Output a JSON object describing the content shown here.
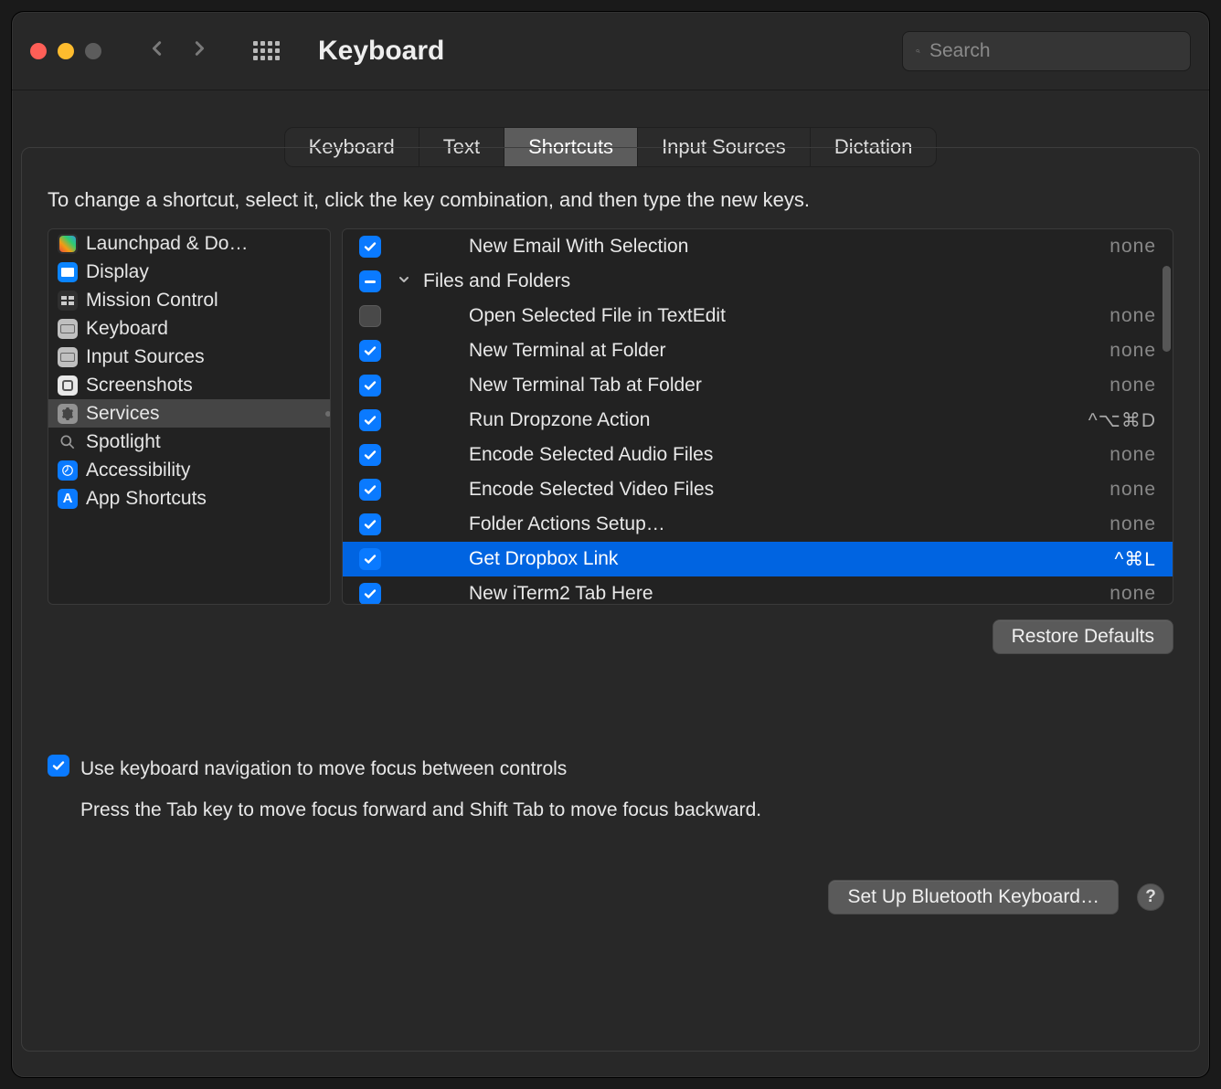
{
  "window": {
    "title": "Keyboard"
  },
  "search": {
    "placeholder": "Search"
  },
  "tabs": [
    "Keyboard",
    "Text",
    "Shortcuts",
    "Input Sources",
    "Dictation"
  ],
  "activeTab": 2,
  "instruction": "To change a shortcut, select it, click the key combination, and then type the new keys.",
  "sidebar": {
    "items": [
      "Launchpad & Do…",
      "Display",
      "Mission Control",
      "Keyboard",
      "Input Sources",
      "Screenshots",
      "Services",
      "Spotlight",
      "Accessibility",
      "App Shortcuts"
    ],
    "selected": 6
  },
  "services": {
    "group_label": "Files and Folders",
    "rows": [
      {
        "checked": true,
        "label": "New Email With Selection",
        "shortcut": "none"
      },
      {
        "group": true,
        "state": "mixed",
        "label": "Files and Folders"
      },
      {
        "checked": false,
        "label": "Open Selected File in TextEdit",
        "shortcut": "none"
      },
      {
        "checked": true,
        "label": "New Terminal at Folder",
        "shortcut": "none"
      },
      {
        "checked": true,
        "label": "New Terminal Tab at Folder",
        "shortcut": "none"
      },
      {
        "checked": true,
        "label": "Run Dropzone Action",
        "shortcut": "^⌥⌘D"
      },
      {
        "checked": true,
        "label": "Encode Selected Audio Files",
        "shortcut": "none"
      },
      {
        "checked": true,
        "label": "Encode Selected Video Files",
        "shortcut": "none"
      },
      {
        "checked": true,
        "label": "Folder Actions Setup…",
        "shortcut": "none"
      },
      {
        "checked": true,
        "label": "Get Dropbox Link",
        "shortcut": "^⌘L",
        "selected": true
      },
      {
        "checked": true,
        "label": "New iTerm2 Tab Here",
        "shortcut": "none"
      }
    ]
  },
  "restoreDefaults": "Restore Defaults",
  "nav_checkbox": {
    "checked": true,
    "label": "Use keyboard navigation to move focus between controls",
    "hint": "Press the Tab key to move focus forward and Shift Tab to move focus backward."
  },
  "footer": {
    "bluetooth": "Set Up Bluetooth Keyboard…",
    "help": "?"
  }
}
